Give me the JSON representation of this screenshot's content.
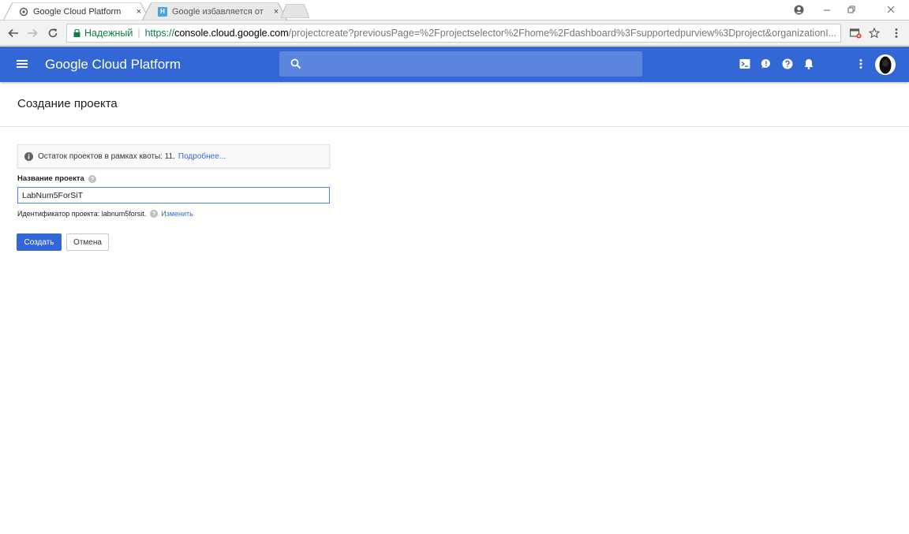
{
  "browser": {
    "tabs": [
      {
        "title": "Google Cloud Platform",
        "active": true
      },
      {
        "title": "Google избавляется от ",
        "favicon_letter": "H",
        "active": false
      }
    ],
    "tab_close_glyph": "×",
    "url": {
      "security_label": "Надежный",
      "scheme": "https://",
      "host": "console.cloud.google.com",
      "path": "/projectcreate?previousPage=%2Fprojectselector%2Fhome%2Fdashboard%3Fsupportedpurview%3Dproject&organizationI..."
    }
  },
  "header": {
    "product_name": "Google Cloud Platform",
    "search_placeholder": "",
    "bar_color": "#3367d6"
  },
  "page": {
    "title": "Создание проекта",
    "quota_text": "Остаток проектов в рамках квоты: 11.",
    "quota_link": "Подробнее...",
    "name_label": "Название проекта",
    "name_value": "LabNum5ForSiT",
    "project_id_text": "Идентификатор проекта: labnum5forsit.",
    "project_id_link": "Изменить",
    "create_label": "Создать",
    "cancel_label": "Отмена"
  }
}
